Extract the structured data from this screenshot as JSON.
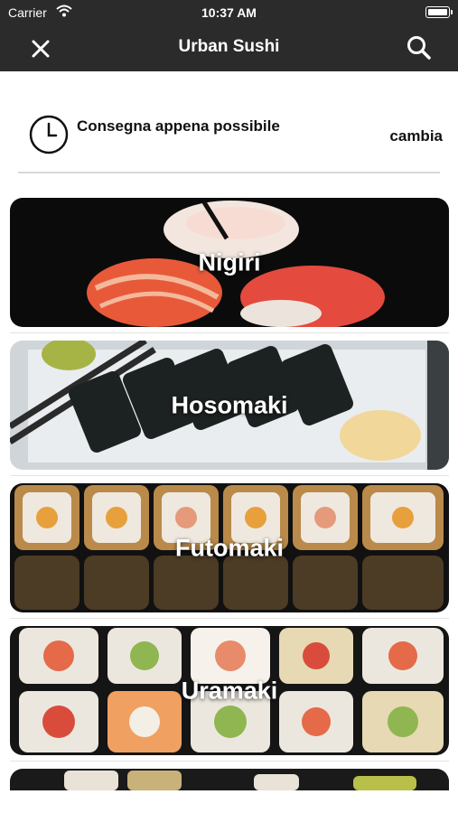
{
  "status_bar": {
    "carrier": "Carrier",
    "time": "10:37 AM"
  },
  "nav": {
    "title": "Urban Sushi",
    "close_icon": "close-icon",
    "search_icon": "search-icon"
  },
  "delivery": {
    "label": "Consegna appena possibile",
    "change": "cambia",
    "icon": "clock-icon"
  },
  "categories": [
    {
      "label": "Nigiri"
    },
    {
      "label": "Hosomaki"
    },
    {
      "label": "Futomaki"
    },
    {
      "label": "Uramaki"
    }
  ],
  "colors": {
    "bar": "#2b2b2b",
    "divider": "#d8d8d8"
  }
}
